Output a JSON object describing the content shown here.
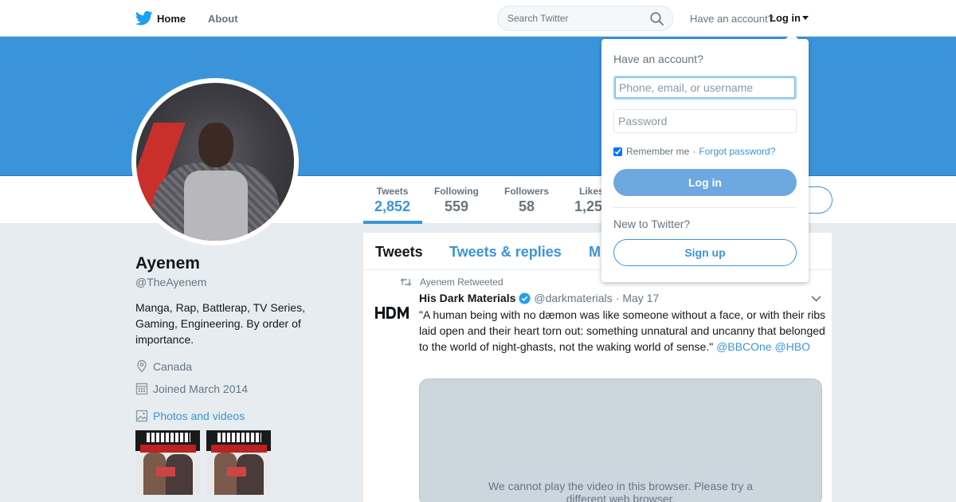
{
  "nav": {
    "home_label": "Home",
    "about_label": "About",
    "search_placeholder": "Search Twitter",
    "have_account": "Have an account?",
    "login_label": "Log in",
    "brand_color": "#1da1f2"
  },
  "profile": {
    "name": "Ayenem",
    "handle": "@TheAyenem",
    "bio": "Manga, Rap, Battlerap, TV Series, Gaming, Engineering. By order of importance.",
    "location": "Canada",
    "joined": "Joined March 2014",
    "photos_label": "Photos and videos",
    "banner_color": "#3b94d9"
  },
  "stats": [
    {
      "label": "Tweets",
      "value": "2,852"
    },
    {
      "label": "Following",
      "value": "559"
    },
    {
      "label": "Followers",
      "value": "58"
    },
    {
      "label": "Likes",
      "value": "1,25"
    }
  ],
  "timeline": {
    "tabs": [
      "Tweets",
      "Tweets & replies",
      "M"
    ],
    "tweet": {
      "retweeted_by": "Ayenem Retweeted",
      "author_name": "His Dark Materials",
      "author_handle": "@darkmaterials",
      "separator": "·",
      "date": "May 17",
      "text": "\"A human being with no dæmon was like someone without a face, or with their ribs laid open and their heart torn out: something unnatural and uncanny that belonged to the world of night-ghasts, not the waking world of sense.\"",
      "mention_1": "@BBCOne",
      "mention_2": "@HBO",
      "media_message": "We cannot play the video in this browser. Please try a different web browser."
    }
  },
  "login_dropdown": {
    "title": "Have an account?",
    "username_placeholder": "Phone, email, or username",
    "password_placeholder": "Password",
    "remember_label": "Remember me",
    "separator": "·",
    "forgot_label": "Forgot password?",
    "login_button": "Log in",
    "new_label": "New to Twitter?",
    "signup_button": "Sign up"
  }
}
